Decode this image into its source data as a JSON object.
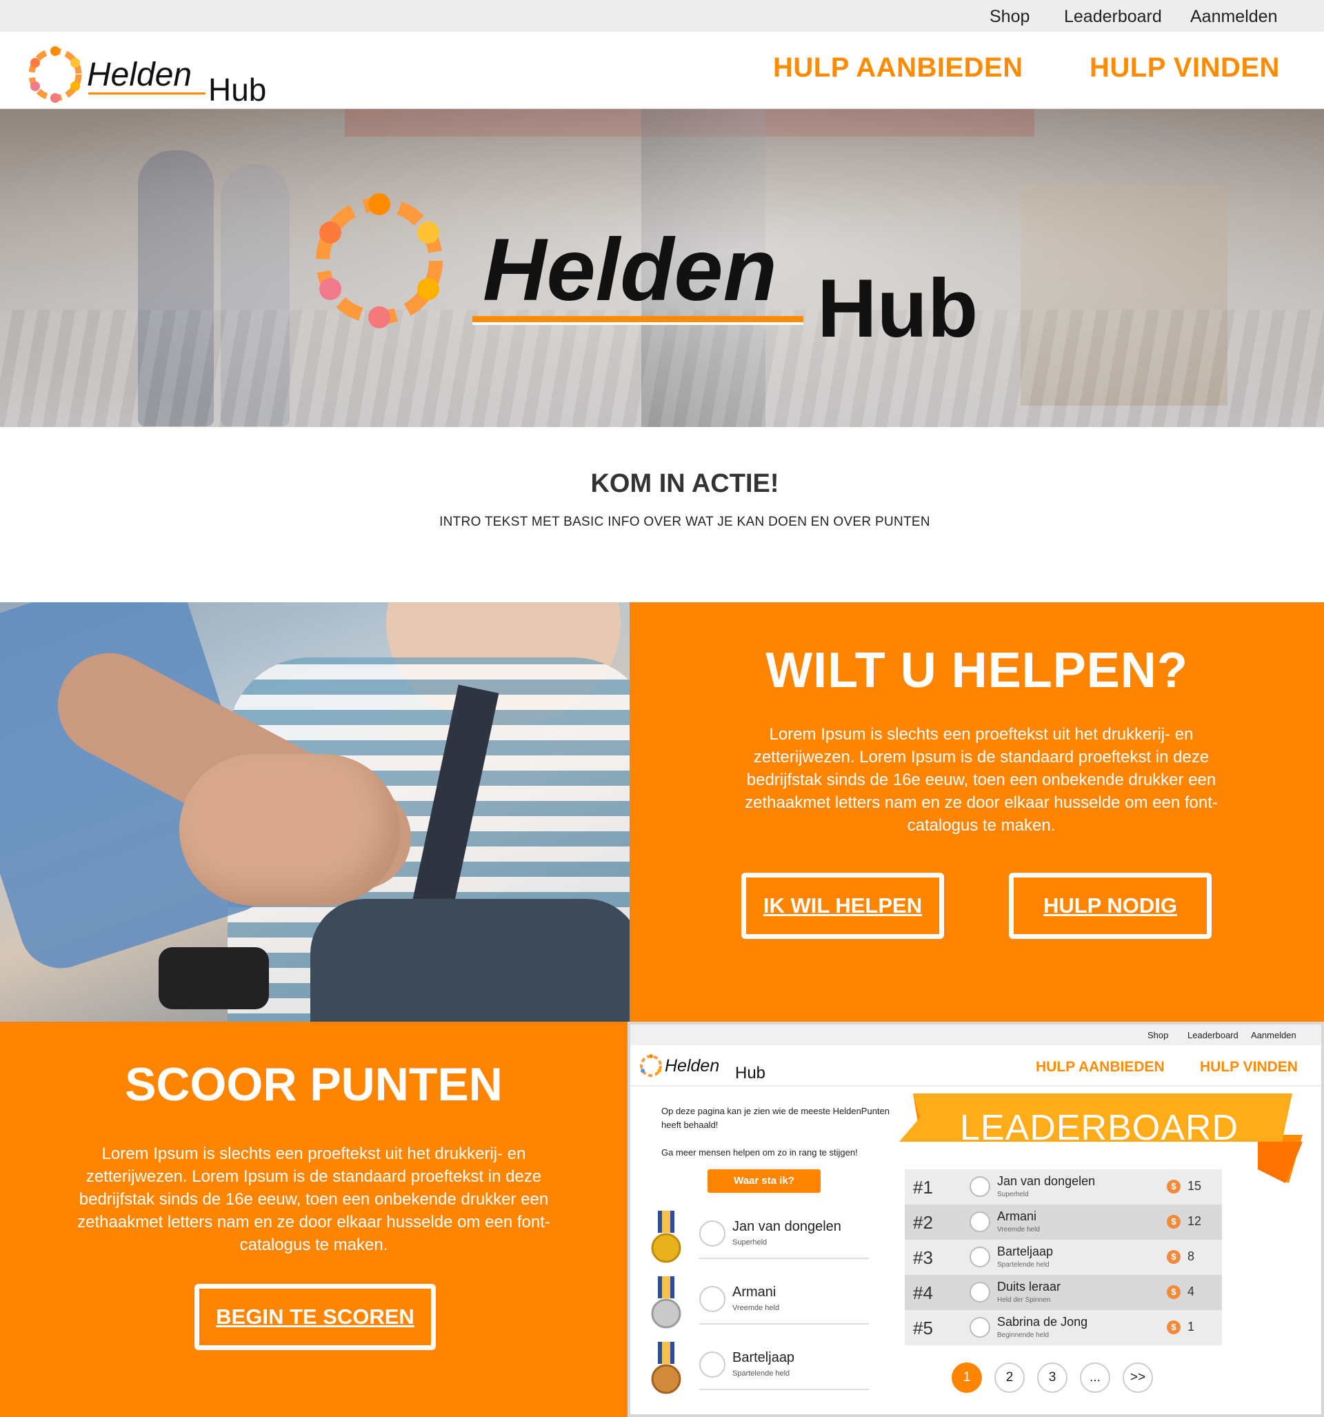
{
  "top_links": {
    "shop": "Shop",
    "leaderboard": "Leaderboard",
    "login": "Aanmelden"
  },
  "brand": {
    "part1": "Helden",
    "part2": "Hub",
    "accent_color": "#ff8500"
  },
  "main_nav": {
    "offer_help": "HULP AANBIEDEN",
    "find_help": "HULP VINDEN"
  },
  "intro": {
    "title": "KOM IN ACTIE!",
    "text": "INTRO TEKST MET BASIC INFO OVER WAT JE KAN DOEN EN OVER PUNTEN"
  },
  "help_section": {
    "title": "WILT U HELPEN?",
    "text": "Lorem Ipsum is slechts een proeftekst uit het drukkerij- en zetterijwezen. Lorem Ipsum is de standaard proeftekst in deze bedrijfstak sinds de 16e eeuw, toen een onbekende drukker een zethaakmet letters nam en ze door elkaar husselde om een font-catalogus te maken.",
    "btn_help": "IK WIL HELPEN",
    "btn_need": "HULP NODIG"
  },
  "score_section": {
    "title": "SCOOR PUNTEN",
    "text": "Lorem Ipsum is slechts een proeftekst uit het drukkerij- en zetterijwezen. Lorem Ipsum is de standaard proeftekst in deze bedrijfstak sinds de 16e eeuw, toen een onbekende drukker een zethaakmet letters nam en ze door elkaar husselde om een font-catalogus te maken.",
    "btn": "BEGIN TE SCOREN"
  },
  "leaderboard_preview": {
    "util": {
      "shop": "Shop",
      "leaderboard": "Leaderboard",
      "login": "Aanmelden"
    },
    "nav": {
      "offer_help": "HULP AANBIEDEN",
      "find_help": "HULP VINDEN"
    },
    "intro_line1": "Op deze pagina kan je zien wie de meeste HeldenPunten heeft behaald!",
    "intro_line2": "Ga meer mensen helpen om zo in rang te stijgen!",
    "cta": "Waar sta ik?",
    "banner": "LEADERBOARD",
    "podium": [
      {
        "name": "Jan van dongelen",
        "rank": "Superheld",
        "medal_color": "#e8b21c"
      },
      {
        "name": "Armani",
        "rank": "Vreemde held",
        "medal_color": "#b9b9b9"
      },
      {
        "name": "Barteljaap",
        "rank": "Spartelende held",
        "medal_color": "#d08a3a"
      }
    ],
    "rows": [
      {
        "pos": "#1",
        "name": "Jan van dongelen",
        "rank": "Superheld",
        "points": "15"
      },
      {
        "pos": "#2",
        "name": "Armani",
        "rank": "Vreemde held",
        "points": "12"
      },
      {
        "pos": "#3",
        "name": "Barteljaap",
        "rank": "Spartelende held",
        "points": "8"
      },
      {
        "pos": "#4",
        "name": "Duits leraar",
        "rank": "Held der Spinnen",
        "points": "4"
      },
      {
        "pos": "#5",
        "name": "Sabrina de Jong",
        "rank": "Beginnende held",
        "points": "1"
      }
    ],
    "coin_symbol": "$",
    "pagination": [
      "1",
      "2",
      "3",
      "...",
      ">>"
    ]
  }
}
